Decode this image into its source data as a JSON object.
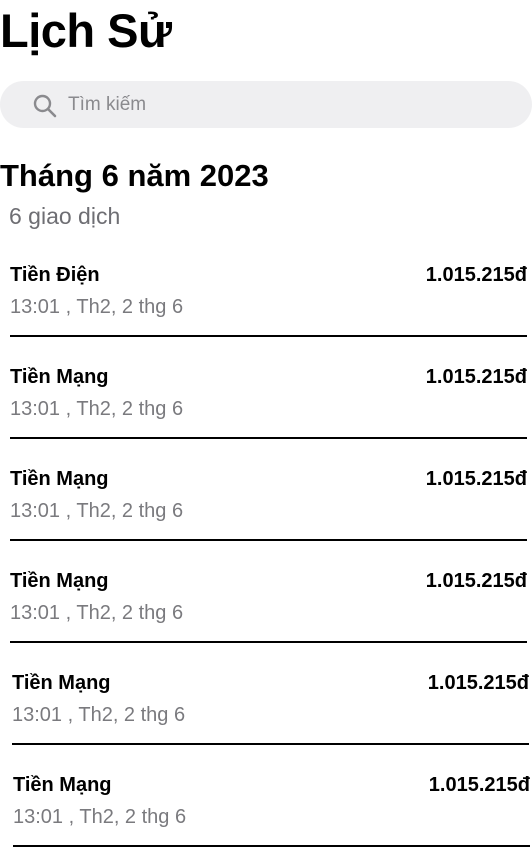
{
  "header": {
    "title": "Lịch Sử"
  },
  "search": {
    "placeholder": "Tìm kiếm",
    "icon": "search-icon"
  },
  "section": {
    "title": "Tháng 6 năm 2023",
    "count": "6 giao dịch"
  },
  "transactions": [
    {
      "name": "Tiền Điện",
      "time": "13:01 , Th2, 2 thg 6",
      "amount": "1.015.215đ"
    },
    {
      "name": "Tiền Mạng",
      "time": "13:01 , Th2, 2 thg 6",
      "amount": "1.015.215đ"
    },
    {
      "name": "Tiền Mạng",
      "time": "13:01 , Th2, 2 thg 6",
      "amount": "1.015.215đ"
    },
    {
      "name": "Tiền Mạng",
      "time": "13:01 , Th2, 2 thg 6",
      "amount": "1.015.215đ"
    },
    {
      "name": "Tiền Mạng",
      "time": "13:01 , Th2, 2 thg 6",
      "amount": "1.015.215đ"
    },
    {
      "name": "Tiền Mạng",
      "time": "13:01 , Th2, 2 thg 6",
      "amount": "1.015.215đ"
    }
  ],
  "colors": {
    "background": "#ffffff",
    "search_background": "#efeff1",
    "secondary_text": "#7a7a7e",
    "divider": "#000000"
  }
}
